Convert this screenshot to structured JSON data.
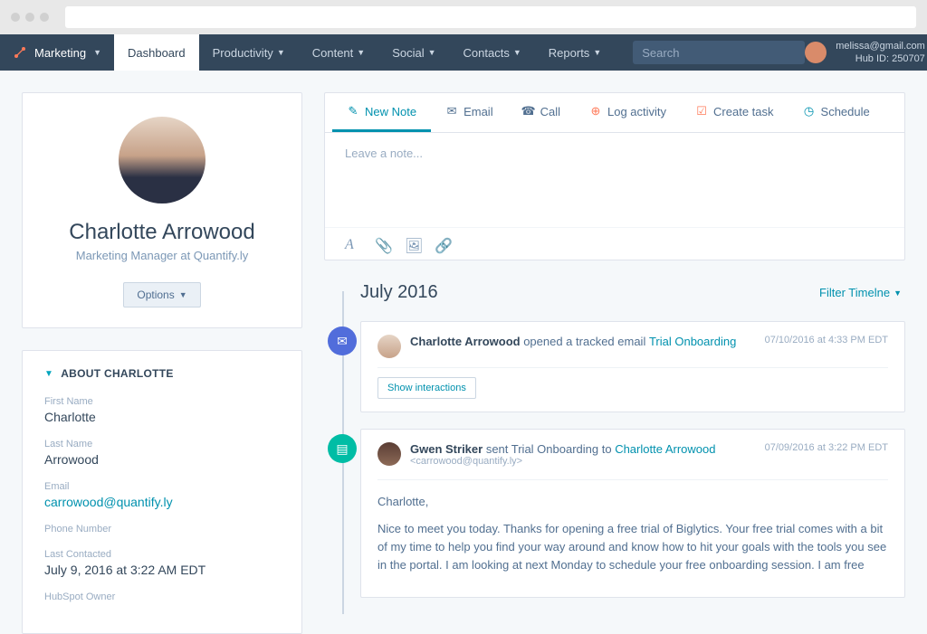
{
  "browser": {
    "url": ""
  },
  "topnav": {
    "brand": "Marketing",
    "items": [
      {
        "label": "Dashboard",
        "active": true,
        "has_dropdown": false
      },
      {
        "label": "Productivity",
        "active": false,
        "has_dropdown": true
      },
      {
        "label": "Content",
        "active": false,
        "has_dropdown": true
      },
      {
        "label": "Social",
        "active": false,
        "has_dropdown": true
      },
      {
        "label": "Contacts",
        "active": false,
        "has_dropdown": true
      },
      {
        "label": "Reports",
        "active": false,
        "has_dropdown": true
      }
    ],
    "search_placeholder": "Search",
    "user": {
      "email": "melissa@gmail.com",
      "hub_id_label": "Hub ID: 250707"
    }
  },
  "profile": {
    "name": "Charlotte Arrowood",
    "title": "Marketing Manager at Quantify.ly",
    "options_btn": "Options"
  },
  "about": {
    "heading": "ABOUT CHARLOTTE",
    "fields": {
      "first_name_label": "First Name",
      "first_name": "Charlotte",
      "last_name_label": "Last Name",
      "last_name": "Arrowood",
      "email_label": "Email",
      "email": "carrowood@quantify.ly",
      "phone_label": "Phone Number",
      "phone": "",
      "last_contacted_label": "Last Contacted",
      "last_contacted": "July 9, 2016 at 3:22 AM EDT",
      "owner_label": "HubSpot Owner"
    }
  },
  "activity_tabs": {
    "new_note": "New Note",
    "email": "Email",
    "call": "Call",
    "log_activity": "Log activity",
    "create_task": "Create task",
    "schedule": "Schedule"
  },
  "note": {
    "placeholder": "Leave a note..."
  },
  "timeline": {
    "month": "July 2016",
    "filter": "Filter Timelne",
    "events": [
      {
        "kind": "email-open",
        "actor": "Charlotte Arrowood",
        "verb": " opened a tracked email ",
        "subject": "Trial Onboarding",
        "time": "07/10/2016 at 4:33 PM EDT",
        "show_interactions": "Show interactions"
      },
      {
        "kind": "email-sent",
        "actor": "Gwen Striker",
        "verb": " sent Trial Onboarding to ",
        "target": "Charlotte Arrowood",
        "address": "<carrowood@quantify.ly>",
        "time": "07/09/2016 at 3:22 PM EDT",
        "greeting": "Charlotte,",
        "body": "Nice to meet you today.  Thanks for opening a free trial of Biglytics.  Your free trial comes with a bit of my time to help you find your way around and know how to hit your goals with the tools you see in the portal.  I am looking at next Monday to schedule your free onboarding session.  I am free"
      }
    ]
  }
}
